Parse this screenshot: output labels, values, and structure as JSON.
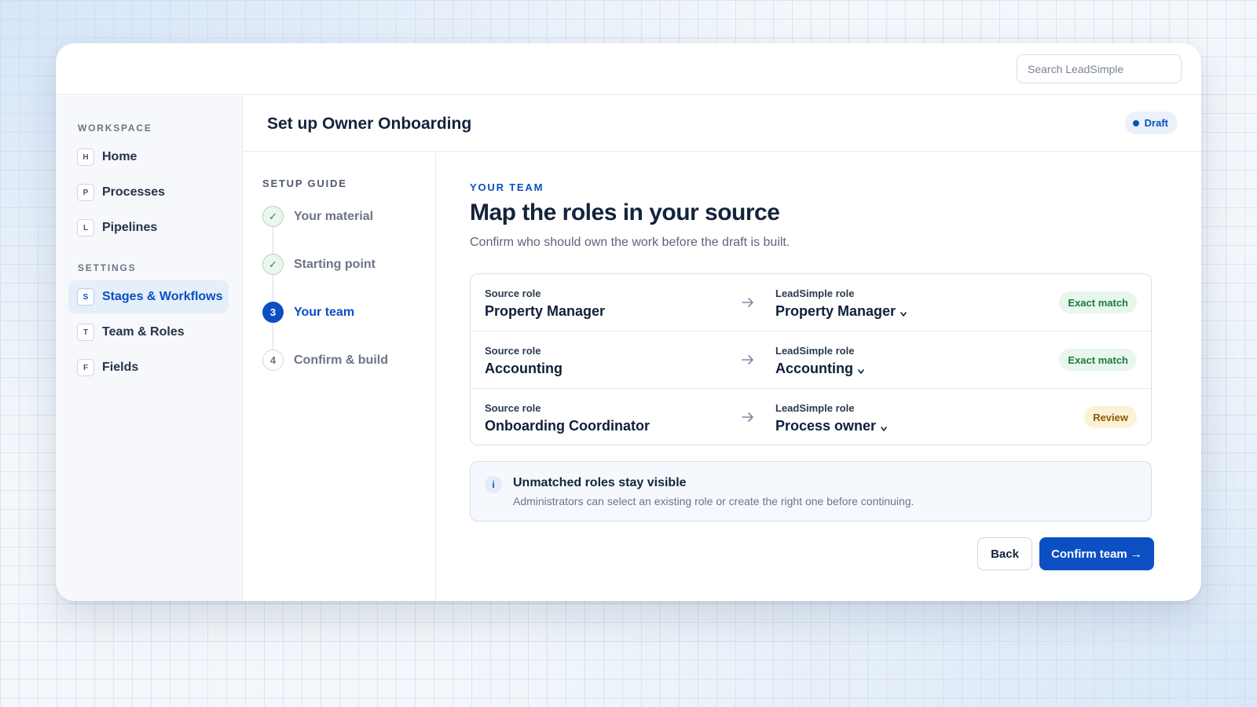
{
  "search": {
    "placeholder": "Search LeadSimple"
  },
  "sidebar": {
    "sections": [
      {
        "label": "WORKSPACE",
        "items": [
          {
            "key": "H",
            "label": "Home"
          },
          {
            "key": "P",
            "label": "Processes"
          },
          {
            "key": "L",
            "label": "Pipelines"
          }
        ]
      },
      {
        "label": "SETTINGS",
        "items": [
          {
            "key": "S",
            "label": "Stages & Workflows",
            "active": true
          },
          {
            "key": "T",
            "label": "Team & Roles"
          },
          {
            "key": "F",
            "label": "Fields"
          }
        ]
      }
    ]
  },
  "header": {
    "title": "Set up Owner Onboarding",
    "status": "Draft"
  },
  "guide": {
    "label": "SETUP GUIDE",
    "steps": [
      {
        "marker": "✓",
        "label": "Your material",
        "state": "done"
      },
      {
        "marker": "✓",
        "label": "Starting point",
        "state": "done"
      },
      {
        "marker": "3",
        "label": "Your team",
        "state": "current"
      },
      {
        "marker": "4",
        "label": "Confirm & build",
        "state": "todo"
      }
    ]
  },
  "main": {
    "eyebrow": "YOUR TEAM",
    "heading": "Map the roles in your source",
    "subtitle": "Confirm who should own the work before the draft is built.",
    "source_label": "Source role",
    "target_label": "LeadSimple role",
    "roles": [
      {
        "source": "Property Manager",
        "target": "Property Manager",
        "status": "Exact match",
        "status_type": "match"
      },
      {
        "source": "Accounting",
        "target": "Accounting",
        "status": "Exact match",
        "status_type": "match"
      },
      {
        "source": "Onboarding Coordinator",
        "target": "Process owner",
        "status": "Review",
        "status_type": "review"
      }
    ],
    "info": {
      "icon": "i",
      "title": "Unmatched roles stay visible",
      "text": "Administrators can select an existing role or create the right one before continuing."
    },
    "buttons": {
      "back": "Back",
      "confirm": "Confirm team →"
    }
  },
  "colors": {
    "accent": "#0b4fc2",
    "match_bg": "#e8f6ed",
    "review_bg": "#fdf2d8"
  }
}
